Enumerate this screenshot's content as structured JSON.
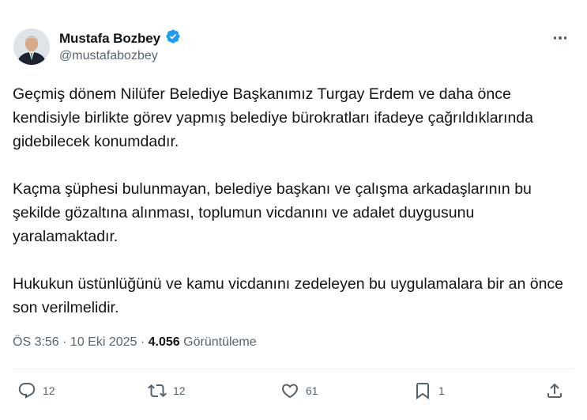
{
  "author": {
    "name": "Mustafa Bozbey",
    "handle": "@mustafabozbey",
    "verified_color": "#1d9bf0"
  },
  "tweet": {
    "paragraphs": [
      "Geçmiş dönem Nilüfer Belediye Başkanımız Turgay Erdem ve daha önce kendisiyle birlikte görev yapmış belediye bürokratları ifadeye çağrıldıklarında gidebilecek konumdadır.",
      "Kaçma şüphesi bulunmayan, belediye başkanı ve çalışma arkadaşlarının bu şekilde gözaltına alınması, toplumun vicdanını ve adalet duygusunu yaralamaktadır.",
      "Hukukun üstünlüğünü ve kamu vicdanını zedeleyen bu uygulamalara bir an önce son verilmelidir."
    ],
    "time": "ÖS 3:56",
    "date": "10 Eki 2025",
    "views_count": "4.056",
    "views_label": "Görüntüleme"
  },
  "actions": {
    "replies": "12",
    "reposts": "12",
    "likes": "61",
    "bookmarks": "1"
  },
  "icons": [
    "verified-badge-icon",
    "more-icon",
    "reply-icon",
    "repost-icon",
    "like-icon",
    "bookmark-icon",
    "share-icon"
  ]
}
